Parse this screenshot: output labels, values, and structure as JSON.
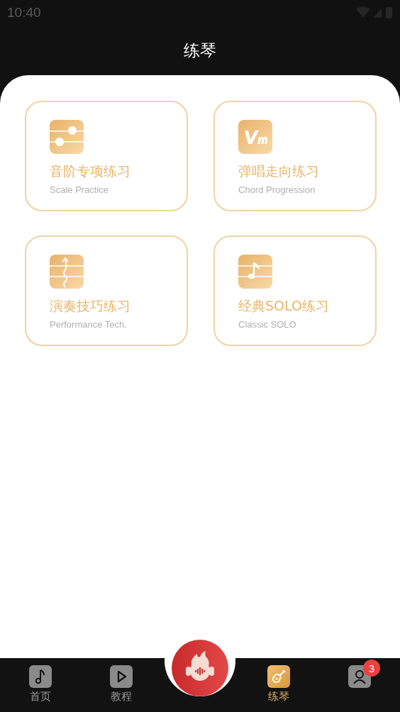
{
  "status_bar": {
    "time": "10:40"
  },
  "header": {
    "title": "练琴"
  },
  "cards": [
    {
      "kind": "scale",
      "title": "音阶专项练习",
      "subtitle": "Scale Practice"
    },
    {
      "kind": "chord",
      "title": "弹唱走向练习",
      "subtitle": "Chord Progression"
    },
    {
      "kind": "technique",
      "title": "演奏技巧练习",
      "subtitle": "Performance Tech."
    },
    {
      "kind": "solo",
      "title": "经典SOLO练习",
      "subtitle": "Classic SOLO"
    }
  ],
  "tabs": [
    {
      "kind": "note",
      "label": "首页",
      "selected": false
    },
    {
      "kind": "play",
      "label": "教程",
      "selected": false
    },
    {
      "kind": "guitar",
      "label": "练琴",
      "selected": true
    },
    {
      "kind": "person",
      "selected": false,
      "badge": "3"
    }
  ]
}
